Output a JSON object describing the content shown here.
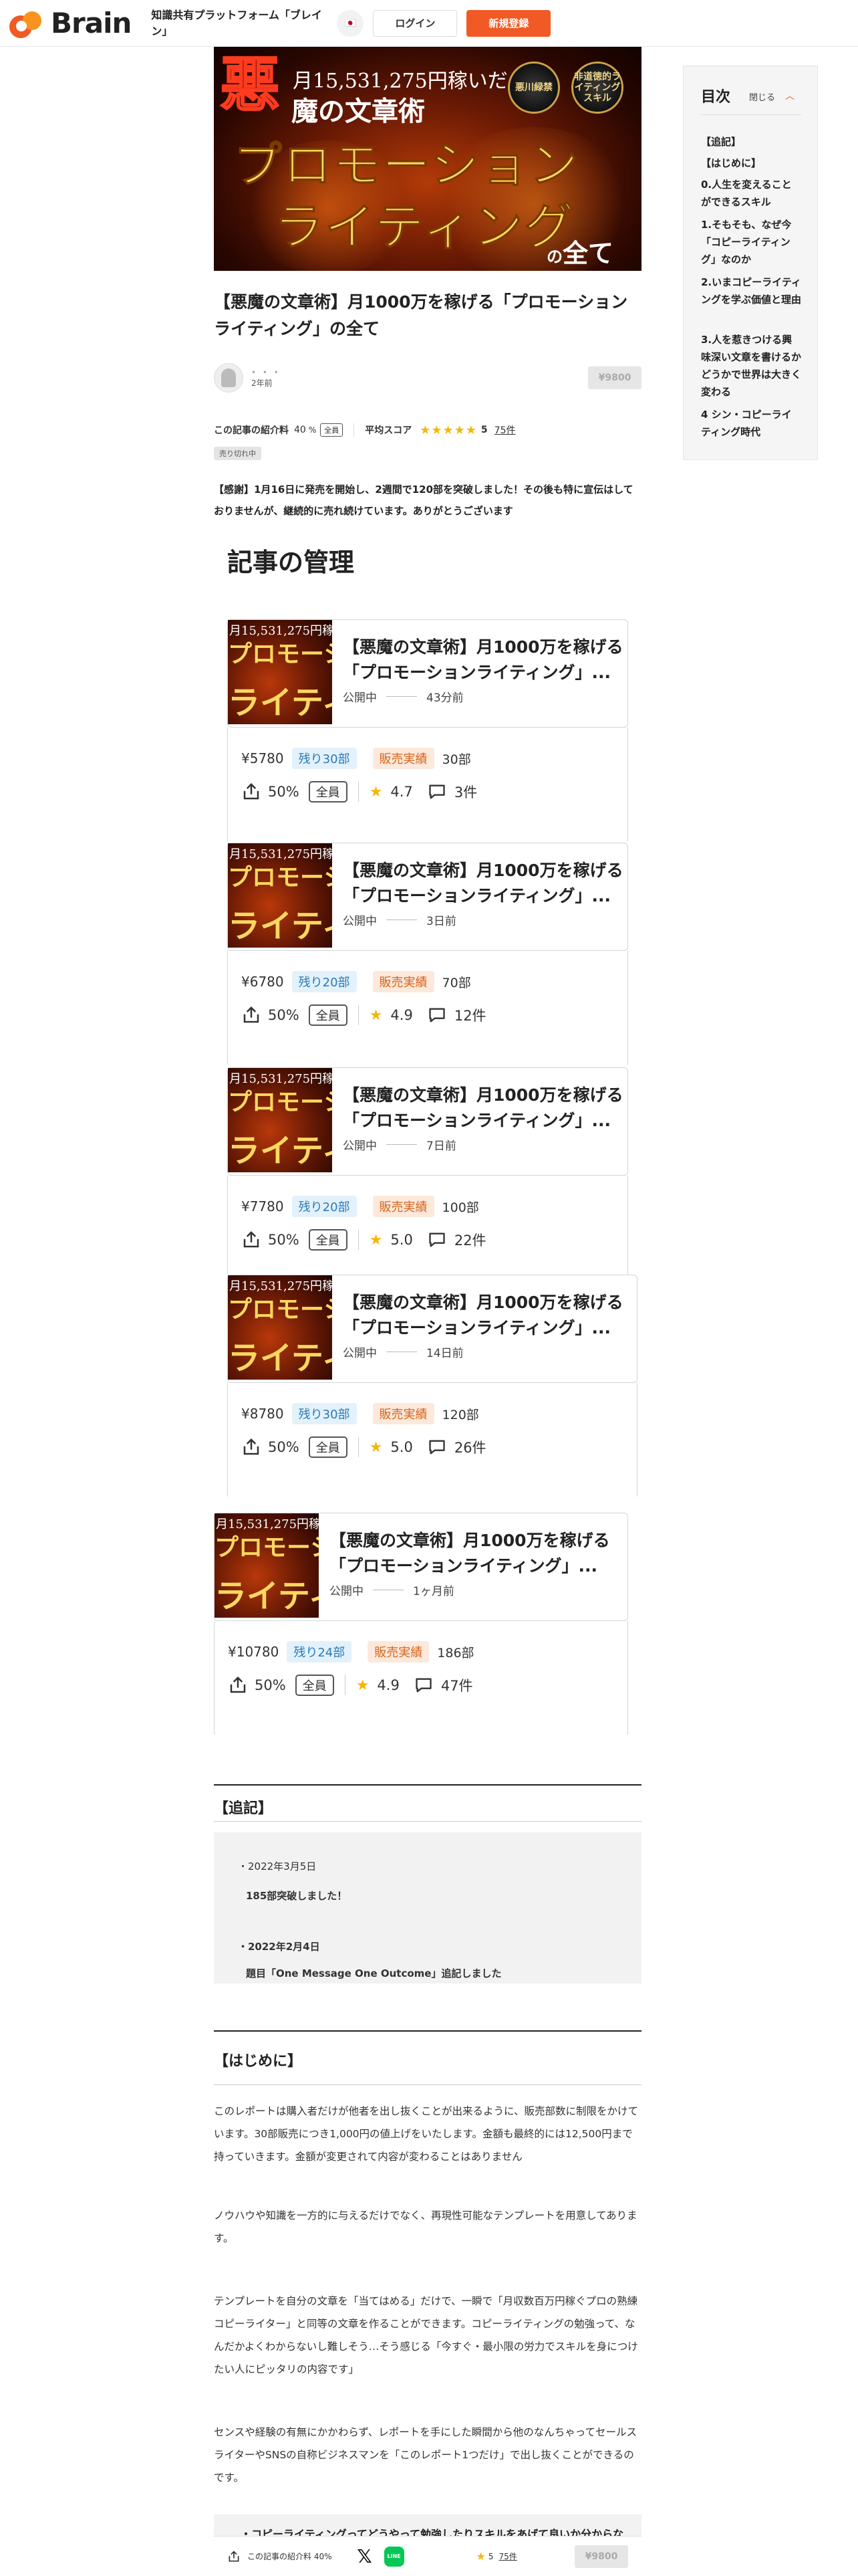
{
  "header": {
    "logo_text": "Brain",
    "tagline": "知識共有プラットフォーム「ブレイン」",
    "lang": "🇯🇵",
    "login_label": "ログイン",
    "signup_label": "新規登録",
    "accent_color": "#f15a24"
  },
  "hero": {
    "akuma": "悪",
    "monthly": "月15,531,275円稼いだ",
    "bunsho": "魔の文章術",
    "seal1": "悪川緑禁",
    "seal2": "非道徳的ライティングスキル",
    "promo": "プロモーション",
    "writing": "ライティング",
    "no": "の",
    "subete": "全て"
  },
  "article": {
    "title": "【悪魔の文章術】月1000万を稼げる「プロモーションライティング」の全て",
    "author_dots": "• • •",
    "posted": "2年前",
    "price": "¥9800",
    "affiliate_label": "この記事の紹介料",
    "affiliate_pct": "40",
    "affiliate_unit": "%",
    "member_tag": "全員",
    "score_label": "平均スコア",
    "stars": "★★★★★",
    "score": "5",
    "reviews": "75件",
    "sold_tag": "売り切れ中",
    "thanks": "【感謝】1月16日に発売を開始し、2週間で120部を突破しました！その後も特に宣伝はしておりませんが、継続的に売れ続けています。ありがとうございます"
  },
  "manage_title": "記事の管理",
  "cards": [
    {
      "title": "【悪魔の文章術】月1000万を稼げる「プロモーションライティング」...",
      "status": "公開中",
      "time": "43分前",
      "price": "¥5780",
      "remain": "残り30部",
      "sold_label": "販売実績",
      "sold": "30部",
      "pct": "50%",
      "member": "全員",
      "rating": "4.7",
      "comments": "3件"
    },
    {
      "title": "【悪魔の文章術】月1000万を稼げる「プロモーションライティング」...",
      "status": "公開中",
      "time": "3日前",
      "price": "¥6780",
      "remain": "残り20部",
      "sold_label": "販売実績",
      "sold": "70部",
      "pct": "50%",
      "member": "全員",
      "rating": "4.9",
      "comments": "12件"
    },
    {
      "title": "【悪魔の文章術】月1000万を稼げる「プロモーションライティング」...",
      "status": "公開中",
      "time": "7日前",
      "price": "¥7780",
      "remain": "残り20部",
      "sold_label": "販売実績",
      "sold": "100部",
      "pct": "50%",
      "member": "全員",
      "rating": "5.0",
      "comments": "22件"
    },
    {
      "title": "【悪魔の文章術】月1000万を稼げる「プロモーションライティング」...",
      "status": "公開中",
      "time": "14日前",
      "price": "¥8780",
      "remain": "残り30部",
      "sold_label": "販売実績",
      "sold": "120部",
      "pct": "50%",
      "member": "全員",
      "rating": "5.0",
      "comments": "26件"
    },
    {
      "title": "【悪魔の文章術】月1000万を稼げる「プロモーションライティング」...",
      "status": "公開中",
      "time": "1ヶ月前",
      "price": "¥10780",
      "remain": "残り24部",
      "sold_label": "販売実績",
      "sold": "186部",
      "pct": "50%",
      "member": "全員",
      "rating": "4.9",
      "comments": "47件"
    }
  ],
  "tsuiki": {
    "heading": "【追記】",
    "items": [
      {
        "date": "・2022年3月5日",
        "text": "185部突破しました！"
      },
      {
        "date": "・2022年2月4日",
        "text": "題目「One Message One Outcome」追記しました"
      }
    ]
  },
  "hajimeni": {
    "heading": "【はじめに】",
    "p1": "このレポートは購入者だけが他者を出し抜くことが出来るように、販売部数に制限をかけています。30部販売につき1,000円の値上げをいたします。金額も最終的には12,500円まで持っていきます。金額が変更されて内容が変わることはありません",
    "p2": "ノウハウや知識を一方的に与えるだけでなく、再現性可能なテンプレートを用意してあります。",
    "p3": "テンプレートを自分の文章を「当てはめる」だけで、一瞬で「月収数百万円稼ぐプロの熟練コピーライター」と同等の文章を作ることができます。コピーライティングの勉強って、なんだかよくわからないし難しそう…そう感じる「今すぐ・最小限の労力でスキルを身につけたい人にピッタリの内容です」",
    "p4": "センスや経験の有無にかかわらず、レポートを手にした瞬間から他のなんちゃってセールスライターやSNSの自称ビジネスマンを「このレポート1つだけ」で出し抜くことができるのです。",
    "list1": "・コピーライティングってどうやって勉強したりスキルをあげて良いか分からな"
  },
  "toc": {
    "title": "目次",
    "close_label": "閉じる",
    "chevron": "︿",
    "items": [
      "【追記】",
      "【はじめに】",
      "0.人生を変えることができるスキル",
      "1.そもそも、なぜ今「コピーライティング」なのか",
      "2.いまコピーライティングを学ぶ価値と理由",
      "3.人を惹きつける興味深い文章を書けるかどうかで世界は大きく変わる",
      "4 シン・コピーライティング時代"
    ]
  },
  "bottombar": {
    "affiliate_text": "この記事の紹介料 40%",
    "x_label": "𝕏",
    "line_label": "LINE",
    "star": "★",
    "score": "5",
    "reviews": "75件",
    "price": "¥9800"
  }
}
